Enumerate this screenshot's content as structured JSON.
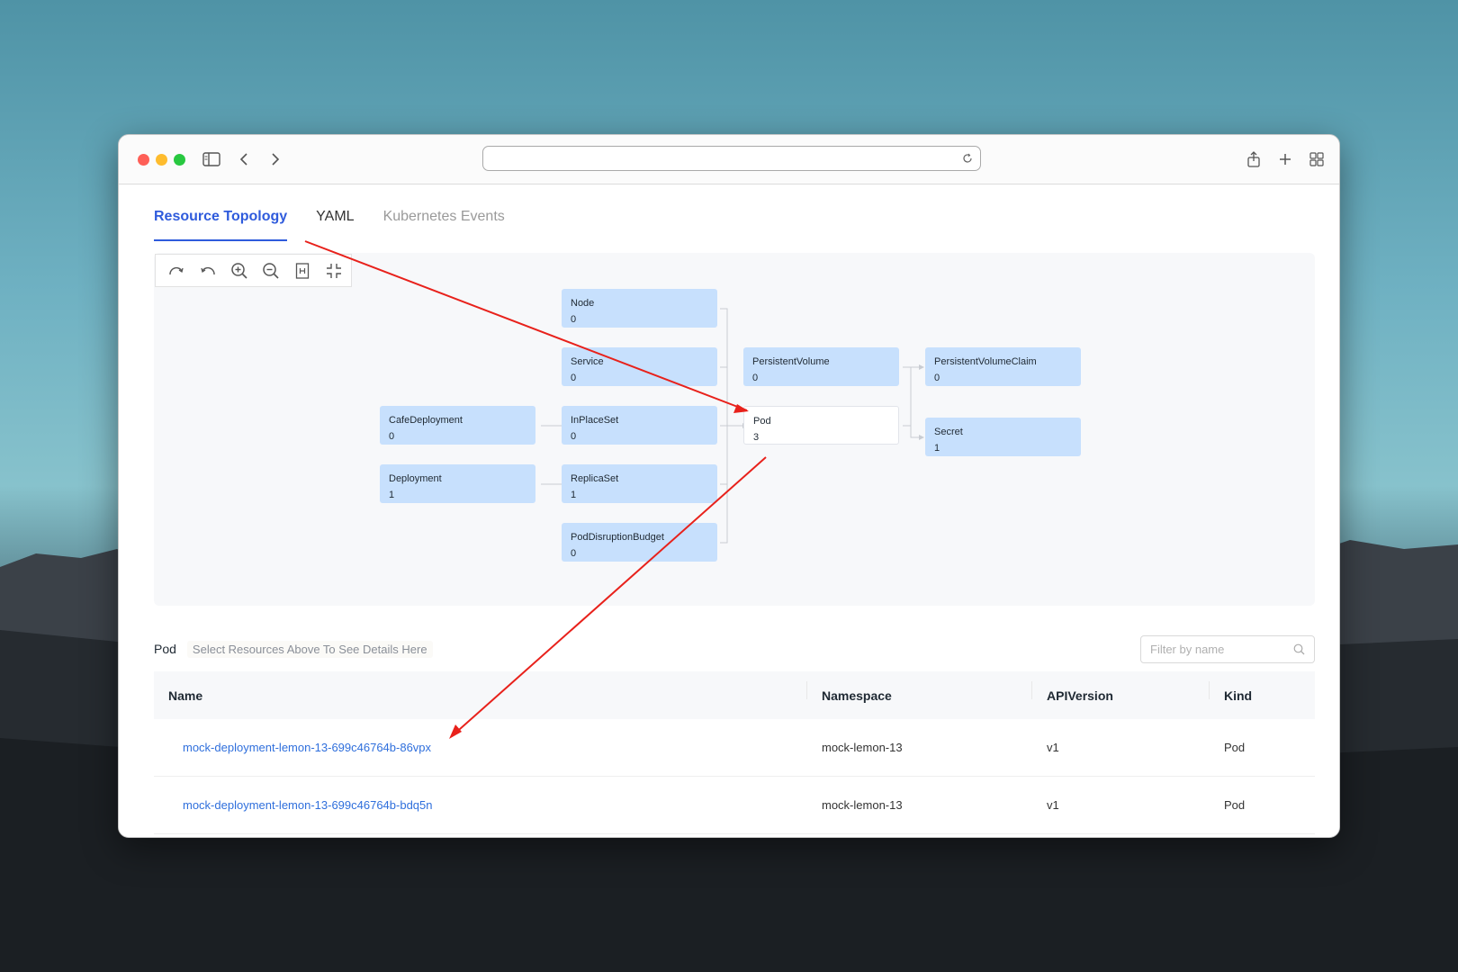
{
  "tabs": [
    {
      "label": "Resource Topology",
      "active": true
    },
    {
      "label": "YAML",
      "active": false
    },
    {
      "label": "Kubernetes Events",
      "active": false
    }
  ],
  "toolbar": [
    "redo-icon",
    "undo-icon",
    "zoom-in-icon",
    "zoom-out-icon",
    "fit-page-icon",
    "center-icon"
  ],
  "topology": {
    "node": {
      "label": "Node",
      "count": "0"
    },
    "service": {
      "label": "Service",
      "count": "0"
    },
    "persistent_volume": {
      "label": "PersistentVolume",
      "count": "0"
    },
    "persistent_volume_claim": {
      "label": "PersistentVolumeClaim",
      "count": "0"
    },
    "cafe_deployment": {
      "label": "CafeDeployment",
      "count": "0"
    },
    "in_place_set": {
      "label": "InPlaceSet",
      "count": "0"
    },
    "pod": {
      "label": "Pod",
      "count": "3"
    },
    "secret": {
      "label": "Secret",
      "count": "1"
    },
    "deployment": {
      "label": "Deployment",
      "count": "1"
    },
    "replica_set": {
      "label": "ReplicaSet",
      "count": "1"
    },
    "pod_disruption_budget": {
      "label": "PodDisruptionBudget",
      "count": "0"
    }
  },
  "details": {
    "kind": "Pod",
    "hint": "Select Resources Above To See Details Here",
    "filter_placeholder": "Filter by name"
  },
  "table": {
    "headers": {
      "name": "Name",
      "namespace": "Namespace",
      "api_version": "APIVersion",
      "kind": "Kind"
    },
    "rows": [
      {
        "name": "mock-deployment-lemon-13-699c46764b-86vpx",
        "namespace": "mock-lemon-13",
        "api_version": "v1",
        "kind": "Pod"
      },
      {
        "name": "mock-deployment-lemon-13-699c46764b-bdq5n",
        "namespace": "mock-lemon-13",
        "api_version": "v1",
        "kind": "Pod"
      }
    ]
  },
  "colors": {
    "accent": "#2f5bdc",
    "node_fill": "#c7e0fd",
    "link": "#2f6fdc",
    "annotation_arrow": "#e8211b"
  }
}
